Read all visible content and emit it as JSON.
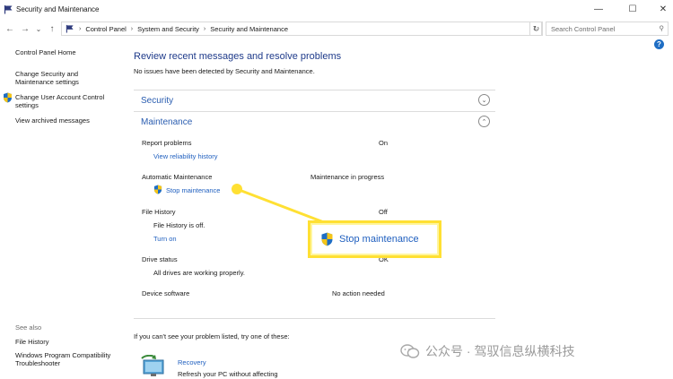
{
  "window": {
    "title": "Security and Maintenance",
    "minimize_glyph": "—",
    "maximize_glyph": "☐",
    "close_glyph": "✕"
  },
  "address_bar": {
    "back_glyph": "←",
    "forward_glyph": "→",
    "history_glyph": "⌄",
    "up_glyph": "↑",
    "crumbs": [
      "Control Panel",
      "System and Security",
      "Security and Maintenance"
    ],
    "separator": "›",
    "dropdown_glyph": "⌄",
    "refresh_glyph": "↻",
    "search_placeholder": "Search Control Panel",
    "search_glyph": "⚲"
  },
  "sidebar": {
    "items": [
      {
        "label": "Control Panel Home"
      },
      {
        "label": "Change Security and Maintenance settings"
      },
      {
        "label": "Change User Account Control settings"
      },
      {
        "label": "View archived messages"
      }
    ],
    "see_also_title": "See also",
    "see_also": [
      {
        "label": "File History"
      },
      {
        "label": "Windows Program Compatibility Troubleshooter"
      }
    ]
  },
  "help": {
    "glyph": "?"
  },
  "main": {
    "heading": "Review recent messages and resolve problems",
    "subheading": "No issues have been detected by Security and Maintenance.",
    "security": {
      "title": "Security",
      "chevron": "⌄"
    },
    "maintenance": {
      "title": "Maintenance",
      "chevron": "⌃",
      "rows": {
        "report_problems": {
          "label": "Report problems",
          "value": "On",
          "link": "View reliability history"
        },
        "automatic_maintenance": {
          "label": "Automatic Maintenance",
          "value": "Maintenance in progress",
          "link": "Stop maintenance"
        },
        "file_history": {
          "label": "File History",
          "value": "Off",
          "sub": "File History is off.",
          "link": "Turn on"
        },
        "drive_status": {
          "label": "Drive status",
          "value": "OK",
          "sub": "All drives are working properly."
        },
        "device_software": {
          "label": "Device software",
          "value": "No action needed"
        }
      }
    },
    "footer_prompt": "If you can't see your problem listed, try one of these:",
    "recovery": {
      "title": "Recovery",
      "desc": "Refresh your PC without affecting"
    }
  },
  "callout": {
    "label": "Stop maintenance"
  },
  "watermark": {
    "text": "公众号 · 驾驭信息纵横科技"
  },
  "colors": {
    "link": "#1f5fbf",
    "heading": "#1e3a8a",
    "callout_border": "#ffe033",
    "shield_blue": "#1f6ec4",
    "shield_yellow": "#f5c518"
  }
}
